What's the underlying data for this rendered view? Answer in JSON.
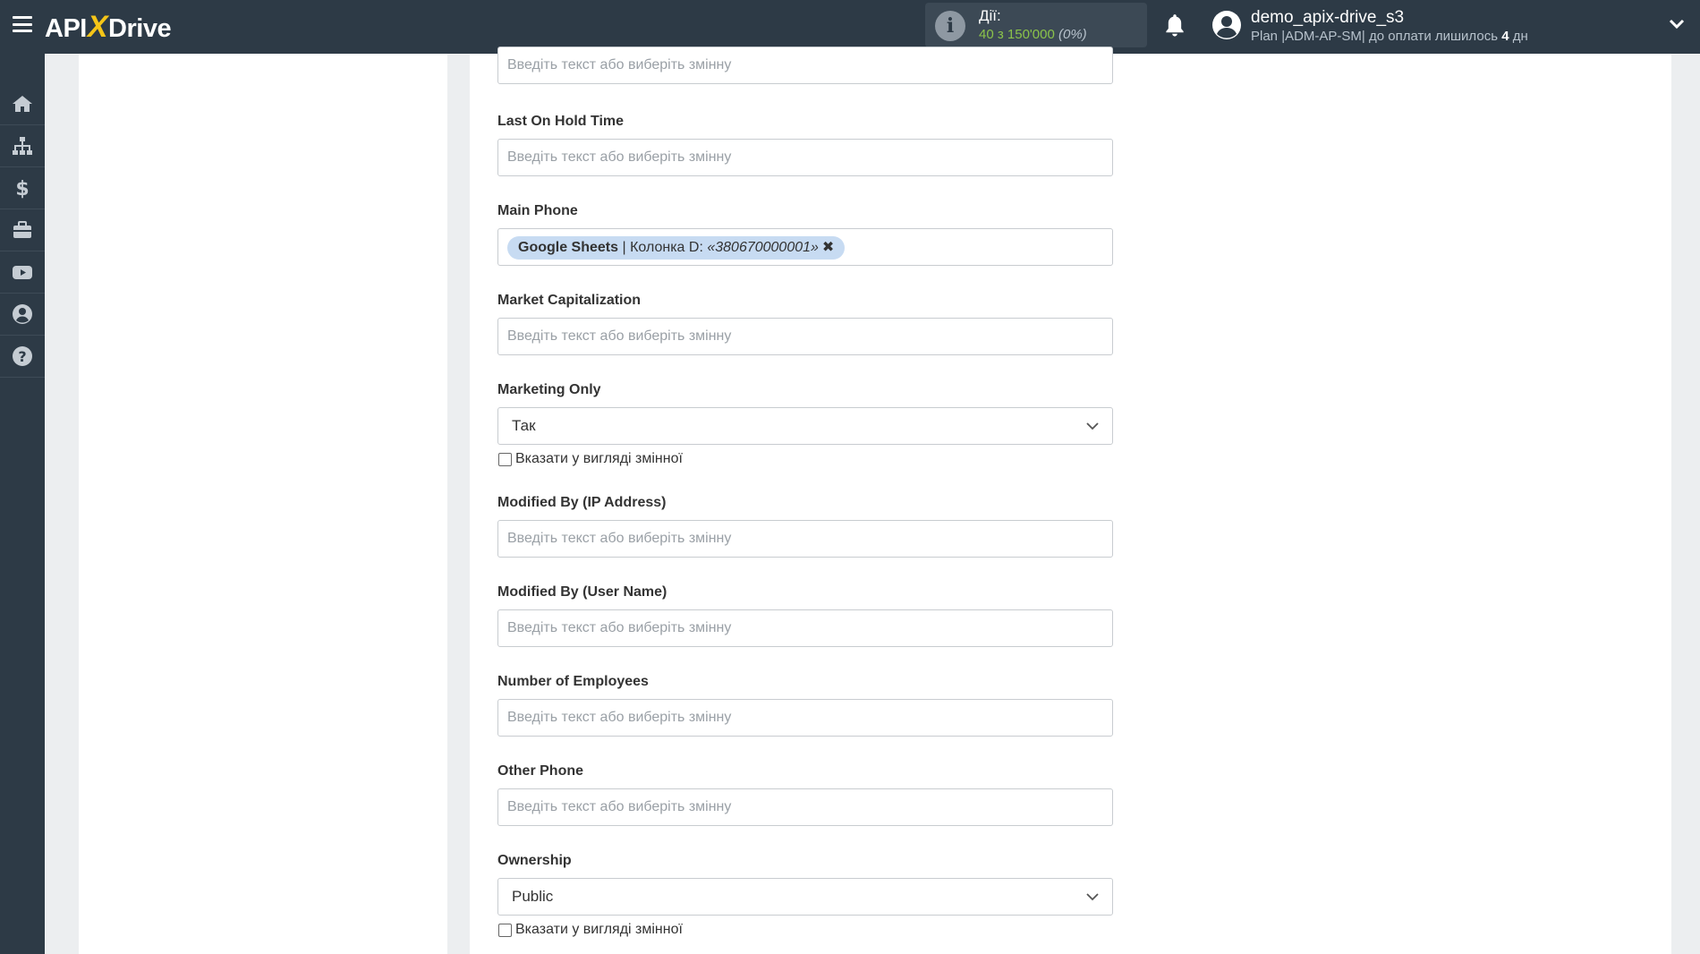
{
  "header": {
    "logo": {
      "prefix": "API",
      "x": "X",
      "suffix": "Drive"
    },
    "actions": {
      "label": "Дії:",
      "count": "40 з 150'000",
      "percent": "(0%)"
    },
    "user": {
      "name": "demo_apix-drive_s3",
      "plan_prefix": "Plan |ADM-AP-SM| до оплати лишилось ",
      "days": "4",
      "days_suffix": " дн"
    }
  },
  "sidebar": {
    "items": [
      {
        "icon": "home-icon"
      },
      {
        "icon": "sitemap-icon"
      },
      {
        "icon": "dollar-icon"
      },
      {
        "icon": "briefcase-icon"
      },
      {
        "icon": "video-icon"
      },
      {
        "icon": "user-icon"
      },
      {
        "icon": "help-icon"
      }
    ]
  },
  "form": {
    "placeholder": "Введіть текст або виберіть змінну",
    "last_on_hold_time": {
      "label": "Last On Hold Time"
    },
    "main_phone": {
      "label": "Main Phone",
      "tag_source": "Google Sheets",
      "tag_column": " | Колонка D: ",
      "tag_value": "«380670000001»",
      "tag_remove": "✖"
    },
    "market_capitalization": {
      "label": "Market Capitalization"
    },
    "marketing_only": {
      "label": "Marketing Only",
      "selected": "Так",
      "checkbox_label": "Вказати у вигляді змінної"
    },
    "modified_by_ip": {
      "label": "Modified By (IP Address)"
    },
    "modified_by_user": {
      "label": "Modified By (User Name)"
    },
    "number_of_employees": {
      "label": "Number of Employees"
    },
    "other_phone": {
      "label": "Other Phone"
    },
    "ownership": {
      "label": "Ownership",
      "selected": "Public",
      "checkbox_label": "Вказати у вигляді змінної"
    }
  }
}
